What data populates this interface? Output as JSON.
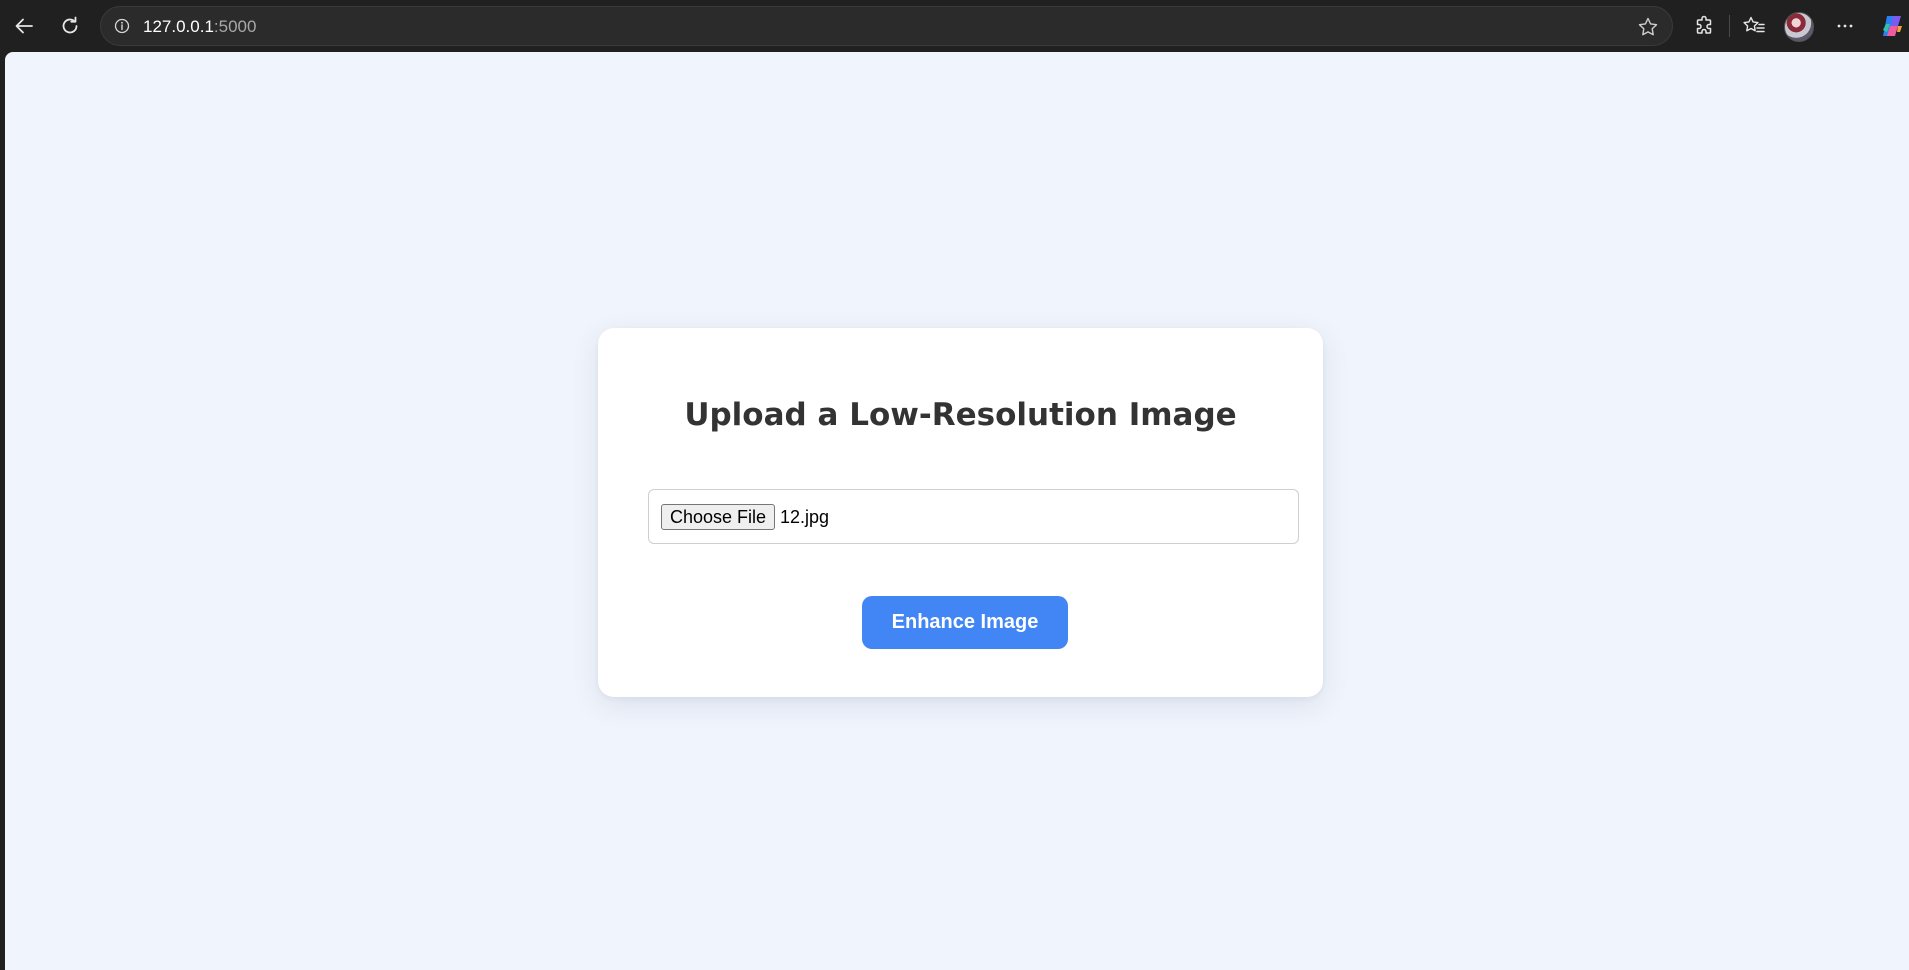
{
  "browser": {
    "url_host": "127.0.0.1",
    "url_port": ":5000",
    "icons": {
      "back": "back-arrow-icon",
      "reload": "reload-icon",
      "info": "info-icon",
      "favorite": "star-icon",
      "extensions": "extensions-icon",
      "favorites": "favorites-icon",
      "profile": "avatar",
      "more": "more-icon",
      "copilot": "copilot-icon"
    }
  },
  "page": {
    "title": "Upload a Low-Resolution Image",
    "file_input": {
      "button_label": "Choose File",
      "selected_file": "12.jpg"
    },
    "submit_label": "Enhance Image",
    "colors": {
      "background": "#f0f4fc",
      "card": "#ffffff",
      "accent": "#4285f4",
      "title": "#333333"
    }
  }
}
